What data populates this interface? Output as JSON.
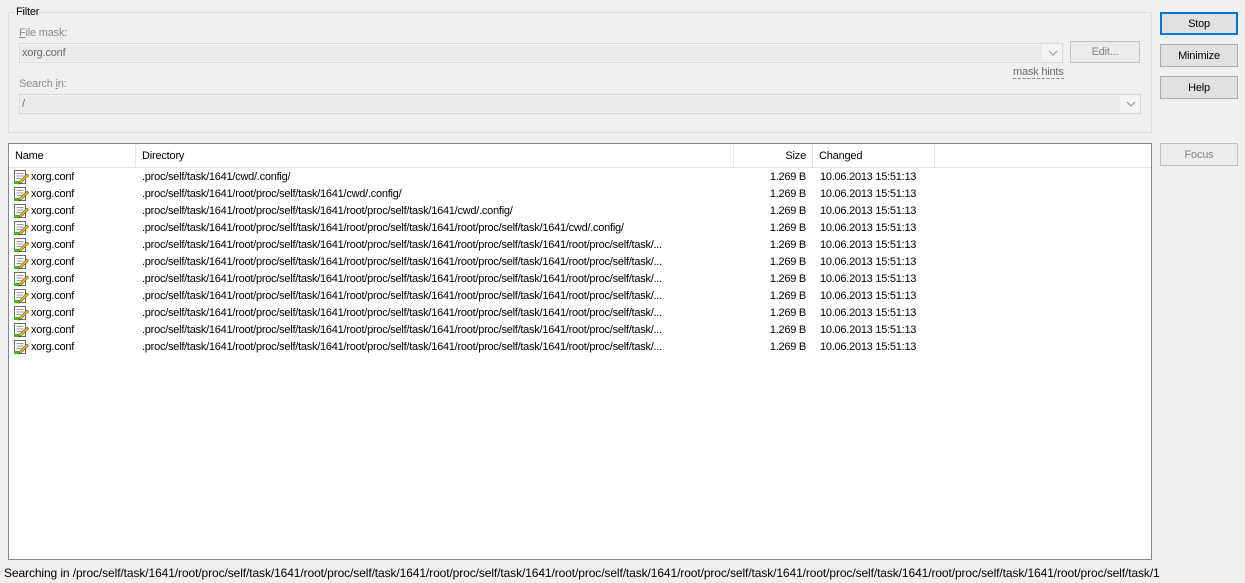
{
  "filter": {
    "legend": "Filter",
    "file_mask_label_prefix": "",
    "file_mask_label_hot": "F",
    "file_mask_label_rest": "ile mask:",
    "file_mask_value": "xorg.conf",
    "edit_label": "Edit...",
    "mask_hints_label": "mask hints",
    "search_in_label_prefix": "Search ",
    "search_in_label_hot": "i",
    "search_in_label_rest": "n:",
    "search_in_value": "/"
  },
  "buttons": {
    "stop": "Stop",
    "minimize": "Minimize",
    "help": "Help",
    "focus": "Focus"
  },
  "list": {
    "columns": {
      "name": "Name",
      "directory": "Directory",
      "size": "Size",
      "changed": "Changed"
    },
    "rows": [
      {
        "name": "xorg.conf",
        "directory": ".proc/self/task/1641/cwd/.config/",
        "size": "1.269 B",
        "changed": "10.06.2013 15:51:13"
      },
      {
        "name": "xorg.conf",
        "directory": ".proc/self/task/1641/root/proc/self/task/1641/cwd/.config/",
        "size": "1.269 B",
        "changed": "10.06.2013 15:51:13"
      },
      {
        "name": "xorg.conf",
        "directory": ".proc/self/task/1641/root/proc/self/task/1641/root/proc/self/task/1641/cwd/.config/",
        "size": "1.269 B",
        "changed": "10.06.2013 15:51:13"
      },
      {
        "name": "xorg.conf",
        "directory": ".proc/self/task/1641/root/proc/self/task/1641/root/proc/self/task/1641/root/proc/self/task/1641/cwd/.config/",
        "size": "1.269 B",
        "changed": "10.06.2013 15:51:13"
      },
      {
        "name": "xorg.conf",
        "directory": ".proc/self/task/1641/root/proc/self/task/1641/root/proc/self/task/1641/root/proc/self/task/1641/root/proc/self/task/...",
        "size": "1.269 B",
        "changed": "10.06.2013 15:51:13"
      },
      {
        "name": "xorg.conf",
        "directory": ".proc/self/task/1641/root/proc/self/task/1641/root/proc/self/task/1641/root/proc/self/task/1641/root/proc/self/task/...",
        "size": "1.269 B",
        "changed": "10.06.2013 15:51:13"
      },
      {
        "name": "xorg.conf",
        "directory": ".proc/self/task/1641/root/proc/self/task/1641/root/proc/self/task/1641/root/proc/self/task/1641/root/proc/self/task/...",
        "size": "1.269 B",
        "changed": "10.06.2013 15:51:13"
      },
      {
        "name": "xorg.conf",
        "directory": ".proc/self/task/1641/root/proc/self/task/1641/root/proc/self/task/1641/root/proc/self/task/1641/root/proc/self/task/...",
        "size": "1.269 B",
        "changed": "10.06.2013 15:51:13"
      },
      {
        "name": "xorg.conf",
        "directory": ".proc/self/task/1641/root/proc/self/task/1641/root/proc/self/task/1641/root/proc/self/task/1641/root/proc/self/task/...",
        "size": "1.269 B",
        "changed": "10.06.2013 15:51:13"
      },
      {
        "name": "xorg.conf",
        "directory": ".proc/self/task/1641/root/proc/self/task/1641/root/proc/self/task/1641/root/proc/self/task/1641/root/proc/self/task/...",
        "size": "1.269 B",
        "changed": "10.06.2013 15:51:13"
      },
      {
        "name": "xorg.conf",
        "directory": ".proc/self/task/1641/root/proc/self/task/1641/root/proc/self/task/1641/root/proc/self/task/1641/root/proc/self/task/...",
        "size": "1.269 B",
        "changed": "10.06.2013 15:51:13"
      }
    ]
  },
  "status": {
    "text": "Searching in /proc/self/task/1641/root/proc/self/task/1641/root/proc/self/task/1641/root/proc/self/task/1641/root/proc/self/task/1641/root/proc/self/task/1641/root/proc/self/task/1641/root/proc/self/task/1641/root/proc/self/task/1"
  },
  "icons": {
    "file": "text-file-edit-icon",
    "dropdown": "chevron-down-icon"
  }
}
